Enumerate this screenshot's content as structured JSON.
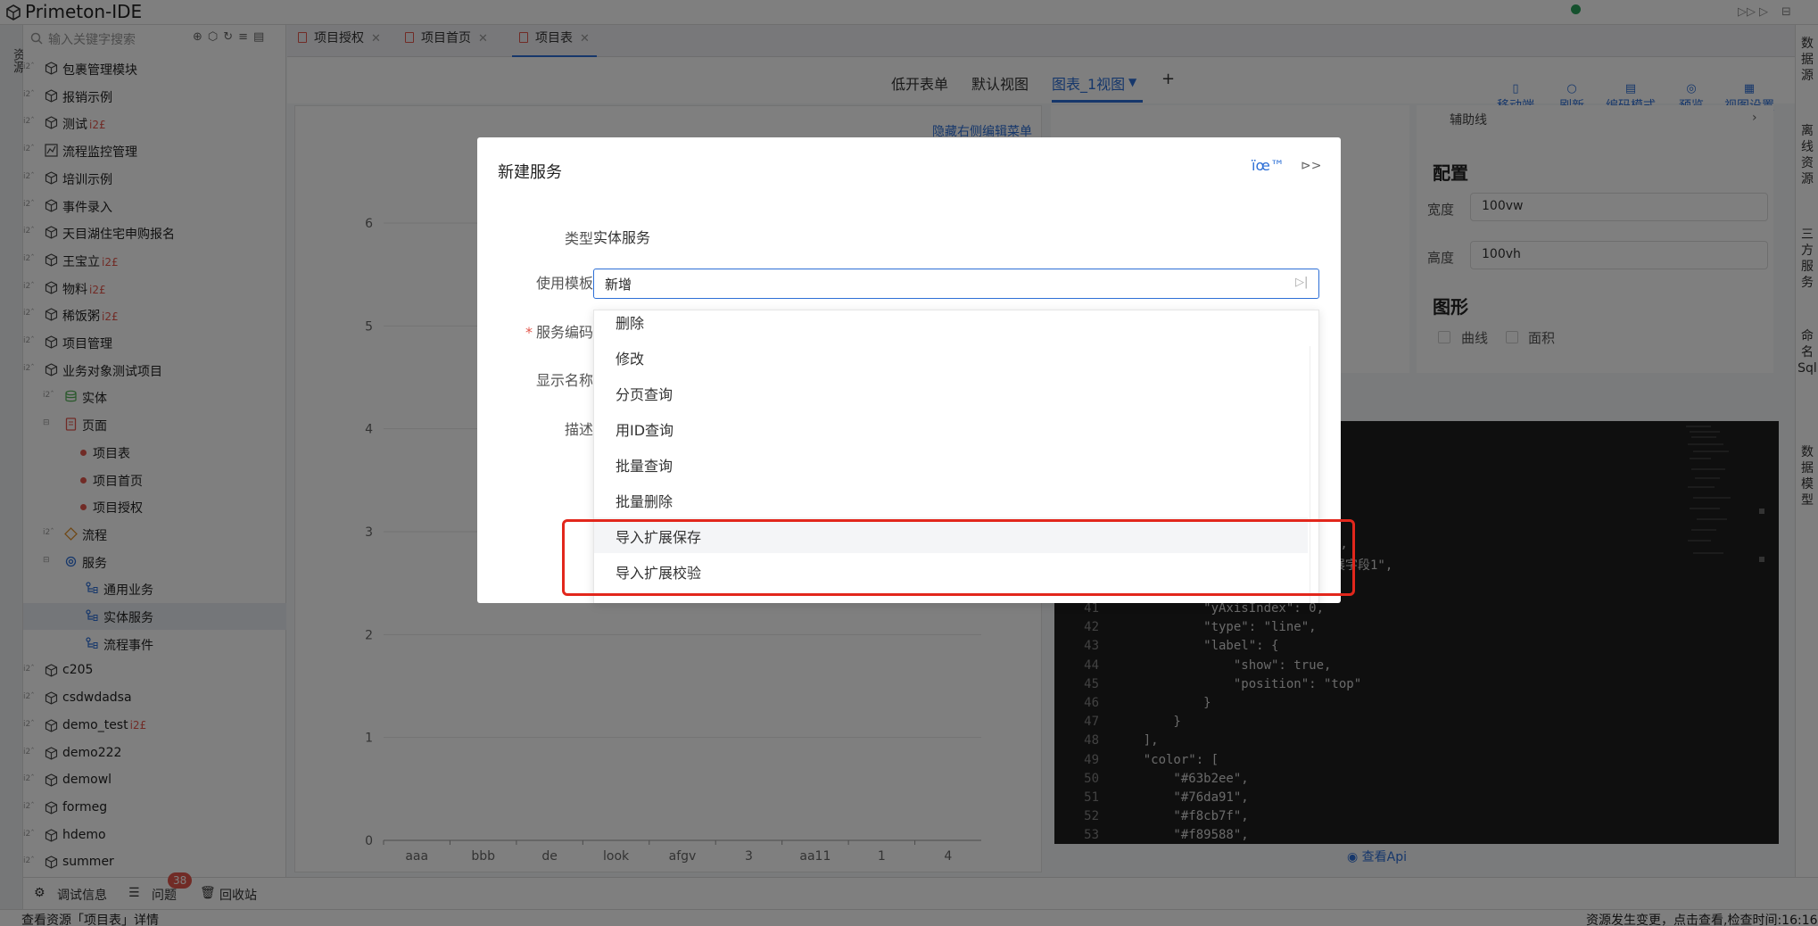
{
  "app": {
    "title": "Primeton-IDE"
  },
  "left_strip": {
    "label": "资源"
  },
  "tree": {
    "search_placeholder": "输入关键字搜索",
    "items": [
      {
        "label": "包裹管理模块",
        "suffix": ""
      },
      {
        "label": "报销示例",
        "suffix": ""
      },
      {
        "label": "测试",
        "suffix": "i2£"
      },
      {
        "label": "流程监控管理",
        "suffix": ""
      },
      {
        "label": "培训示例",
        "suffix": ""
      },
      {
        "label": "事件录入",
        "suffix": ""
      },
      {
        "label": "天目湖住宅申购报名",
        "suffix": ""
      },
      {
        "label": "王宝立",
        "suffix": "i2£"
      },
      {
        "label": "物料",
        "suffix": "i2£"
      },
      {
        "label": "稀饭粥",
        "suffix": "i2£"
      },
      {
        "label": "项目管理",
        "suffix": ""
      },
      {
        "label": "业务对象测试项目",
        "suffix": ""
      },
      {
        "label": "实体",
        "suffix": ""
      },
      {
        "label": "页面",
        "suffix": ""
      },
      {
        "label": "项目表",
        "suffix": ""
      },
      {
        "label": "项目首页",
        "suffix": ""
      },
      {
        "label": "项目授权",
        "suffix": ""
      },
      {
        "label": "流程",
        "suffix": ""
      },
      {
        "label": "服务",
        "suffix": ""
      },
      {
        "label": "通用业务",
        "suffix": ""
      },
      {
        "label": "实体服务",
        "suffix": ""
      },
      {
        "label": "流程事件",
        "suffix": ""
      },
      {
        "label": "c205",
        "suffix": ""
      },
      {
        "label": "csdwdadsa",
        "suffix": ""
      },
      {
        "label": "demo_test",
        "suffix": "i2£"
      },
      {
        "label": "demo222",
        "suffix": ""
      },
      {
        "label": "demowl",
        "suffix": ""
      },
      {
        "label": "formeg",
        "suffix": ""
      },
      {
        "label": "hdemo",
        "suffix": ""
      },
      {
        "label": "summer",
        "suffix": ""
      }
    ]
  },
  "tabs": [
    {
      "label": "项目授权"
    },
    {
      "label": "项目首页"
    },
    {
      "label": "项目表"
    }
  ],
  "views": {
    "tabs": [
      "低开表单",
      "默认视图",
      "图表_1视图"
    ],
    "add": "+",
    "actions": [
      "移动端",
      "刷新",
      "编码模式",
      "预览",
      "视图设置"
    ]
  },
  "canvas": {
    "hide_menu": "隐藏右侧编辑菜单"
  },
  "chart_data": {
    "type": "line",
    "categories": [
      "aaa",
      "bbb",
      "de",
      "look",
      "afgv",
      "3",
      "aa11",
      "1",
      "4"
    ],
    "y_ticks": [
      "0",
      "1",
      "2",
      "3",
      "4",
      "5",
      "6"
    ],
    "ylim": [
      0,
      6
    ],
    "grid": true
  },
  "config": {
    "aux_line": "辅助线",
    "heading": "配置",
    "width_label": "宽度",
    "width_value": "100vw",
    "height_label": "高度",
    "height_value": "100vh",
    "shape_heading": "图形",
    "curve_label": "曲线",
    "area_label": "面积"
  },
  "code": {
    "partial_lines": [
      {
        "ln": "",
        "text": "\","
      },
      {
        "ln": "",
        "text": "展字段1\","
      }
    ],
    "lines": [
      {
        "ln": "41",
        "text": "            \"yAxisIndex\": 0,"
      },
      {
        "ln": "42",
        "text": "            \"type\": \"line\","
      },
      {
        "ln": "43",
        "text": "            \"label\": {"
      },
      {
        "ln": "44",
        "text": "                \"show\": true,"
      },
      {
        "ln": "45",
        "text": "                \"position\": \"top\""
      },
      {
        "ln": "46",
        "text": "            }"
      },
      {
        "ln": "47",
        "text": "        }"
      },
      {
        "ln": "48",
        "text": "    ],"
      },
      {
        "ln": "49",
        "text": "    \"color\": ["
      },
      {
        "ln": "50",
        "text": "        \"#63b2ee\","
      },
      {
        "ln": "51",
        "text": "        \"#76da91\","
      },
      {
        "ln": "52",
        "text": "        \"#f8cb7f\","
      },
      {
        "ln": "53",
        "text": "        \"#f89588\","
      }
    ],
    "api_link": "查看Api"
  },
  "right_strip": [
    "数据源",
    "离线资源",
    "三方服务",
    "命名Sql",
    "数据模型"
  ],
  "bottom": {
    "debug": "调试信息",
    "problems": "问题",
    "problems_count": "38",
    "recycle": "回收站"
  },
  "status": {
    "left": "查看资源「项目表」详情",
    "right": "资源发生变更，点击查看,检查时间:16:16"
  },
  "dialog": {
    "title": "新建服务",
    "license_text": "ïœ™",
    "type_label": "类型",
    "type_value": "实体服务",
    "template_label": "使用模板",
    "template_value": "新增",
    "code_label": "服务编码",
    "name_label": "显示名称",
    "desc_label": "描述",
    "options": [
      "删除",
      "修改",
      "分页查询",
      "用ID查询",
      "批量查询",
      "批量删除",
      "导入扩展保存",
      "导入扩展校验"
    ]
  },
  "colors": {
    "accent": "#2d6fd6",
    "danger": "#e2271c",
    "status_ok": "#2aa35c"
  }
}
